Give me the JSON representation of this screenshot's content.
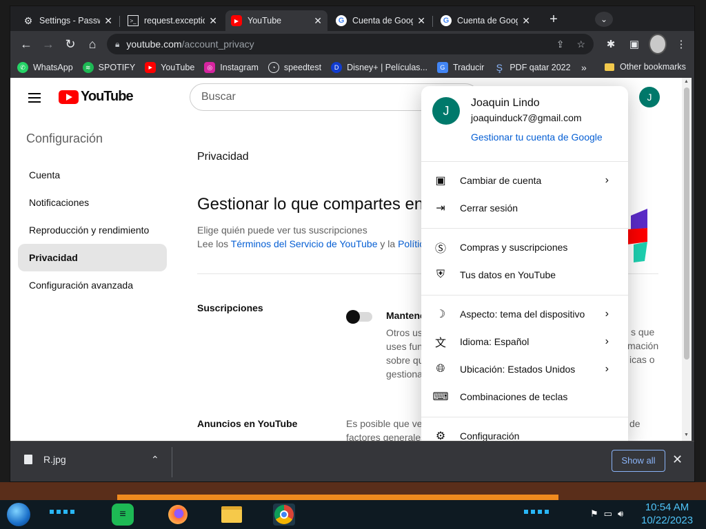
{
  "tabs": [
    {
      "label": "Settings - Passw",
      "icon": "gear-icon"
    },
    {
      "label": "request.exceptio",
      "icon": "terminal-icon"
    },
    {
      "label": "YouTube",
      "icon": "youtube-icon"
    },
    {
      "label": "Cuenta de Goog",
      "icon": "google-icon"
    },
    {
      "label": "Cuenta de Goog",
      "icon": "google-icon"
    }
  ],
  "toolbar": {
    "url_host": "youtube.com",
    "url_path": "/account_privacy"
  },
  "bookmarks": [
    {
      "label": "WhatsApp",
      "color": "#25d366"
    },
    {
      "label": "SPOTIFY",
      "color": "#1db954"
    },
    {
      "label": "YouTube",
      "color": "#ff0000"
    },
    {
      "label": "Instagram",
      "color": "#d6249f"
    },
    {
      "label": "speedtest",
      "color": "#202124"
    },
    {
      "label": "Disney+ | Películas...",
      "color": "#113ccf"
    },
    {
      "label": "Traducir",
      "color": "#4285f4"
    },
    {
      "label": "PDF qatar 2022",
      "color": "#1a73e8"
    }
  ],
  "bookmarks_other": "Other bookmarks",
  "youtube": {
    "logo": "YouTube",
    "search_placeholder": "Buscar",
    "avatar_letter": "J"
  },
  "sidebar": {
    "title": "Configuración",
    "items": [
      {
        "label": "Cuenta"
      },
      {
        "label": "Notificaciones"
      },
      {
        "label": "Reproducción y rendimiento"
      },
      {
        "label": "Privacidad"
      },
      {
        "label": "Configuración avanzada"
      }
    ]
  },
  "main": {
    "section": "Privacidad",
    "heading": "Gestionar lo que compartes en",
    "desc1": "Elige quién puede ver tus suscripciones",
    "desc2_pre": "Lee los ",
    "desc2_link": "Términos del Servicio de YouTube",
    "desc2_mid": " y la ",
    "desc2_link2": "Polític",
    "subs_title": "Suscripciones",
    "subs_option": "Mantene",
    "subs_sub": [
      "Otros us",
      "uses fun",
      "sobre qu",
      "gestiona"
    ],
    "right_frag": [
      "s que",
      "mación",
      "icas o"
    ],
    "ads_title": "Anuncios en YouTube",
    "ads_desc": [
      "Es posible que ve",
      "factores generales"
    ],
    "ads_right": "de"
  },
  "account_menu": {
    "avatar_letter": "J",
    "name": "Joaquin Lindo",
    "email": "joaquinduck7@gmail.com",
    "manage": "Gestionar tu cuenta de Google",
    "items": [
      {
        "label": "Cambiar de cuenta",
        "icon": "switch-account-icon",
        "chevron": true
      },
      {
        "label": "Cerrar sesión",
        "icon": "sign-out-icon",
        "chevron": false
      },
      {
        "label": "Compras y suscripciones",
        "icon": "dollar-icon",
        "chevron": false
      },
      {
        "label": "Tus datos en YouTube",
        "icon": "shield-user-icon",
        "chevron": false
      },
      {
        "label": "Aspecto: tema del dispositivo",
        "icon": "moon-icon",
        "chevron": true
      },
      {
        "label": "Idioma: Español",
        "icon": "translate-icon",
        "chevron": true
      },
      {
        "label": "Ubicación: Estados Unidos",
        "icon": "globe-icon",
        "chevron": true
      },
      {
        "label": "Combinaciones de teclas",
        "icon": "keyboard-icon",
        "chevron": false
      },
      {
        "label": "Configuración",
        "icon": "gear-icon",
        "chevron": false
      }
    ]
  },
  "download": {
    "filename": "R.jpg",
    "show_all": "Show all"
  },
  "taskbar": {
    "time": "10:54 AM",
    "date": "10/22/2023"
  }
}
